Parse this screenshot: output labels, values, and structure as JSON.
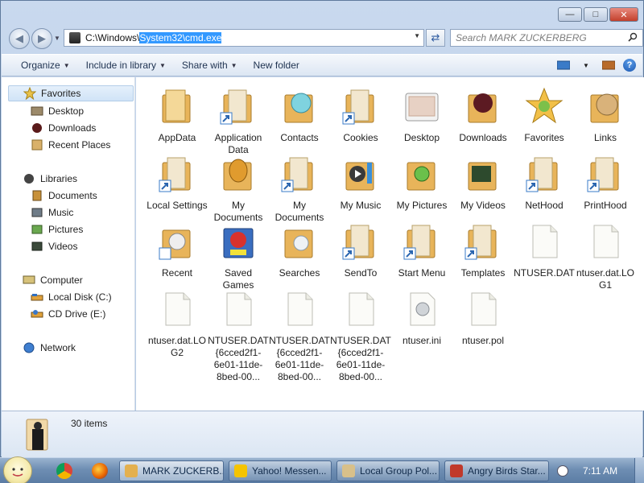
{
  "address": {
    "path_prefix": "C:\\Windows\\",
    "path_selected": "System32\\cmd.exe"
  },
  "search": {
    "placeholder": "Search MARK ZUCKERBERG"
  },
  "toolbar": {
    "organize": "Organize",
    "include_in_library": "Include in library",
    "share_with": "Share with",
    "new_folder": "New folder"
  },
  "nav": {
    "favorites": "Favorites",
    "desktop": "Desktop",
    "downloads": "Downloads",
    "recent_places": "Recent Places",
    "libraries": "Libraries",
    "documents": "Documents",
    "music": "Music",
    "pictures": "Pictures",
    "videos": "Videos",
    "computer": "Computer",
    "local_disk": "Local Disk (C:)",
    "cd_drive": "CD Drive (E:)",
    "network": "Network"
  },
  "files": [
    {
      "label": "AppData",
      "icon": "folder-icon"
    },
    {
      "label": "Application Data",
      "icon": "folder-shortcut-icon"
    },
    {
      "label": "Contacts",
      "icon": "contacts-folder-icon"
    },
    {
      "label": "Cookies",
      "icon": "folder-shortcut-icon"
    },
    {
      "label": "Desktop",
      "icon": "desktop-folder-icon"
    },
    {
      "label": "Downloads",
      "icon": "downloads-folder-icon"
    },
    {
      "label": "Favorites",
      "icon": "favorites-folder-icon"
    },
    {
      "label": "Links",
      "icon": "links-folder-icon"
    },
    {
      "label": "Local Settings",
      "icon": "folder-shortcut-icon"
    },
    {
      "label": "My Documents",
      "icon": "documents-folder-icon"
    },
    {
      "label": "My Documents",
      "icon": "folder-shortcut-icon"
    },
    {
      "label": "My Music",
      "icon": "music-folder-icon"
    },
    {
      "label": "My Pictures",
      "icon": "pictures-folder-icon"
    },
    {
      "label": "My Videos",
      "icon": "videos-folder-icon"
    },
    {
      "label": "NetHood",
      "icon": "folder-shortcut-icon"
    },
    {
      "label": "PrintHood",
      "icon": "folder-shortcut-icon"
    },
    {
      "label": "Recent",
      "icon": "recent-folder-icon"
    },
    {
      "label": "Saved Games",
      "icon": "saved-games-folder-icon"
    },
    {
      "label": "Searches",
      "icon": "searches-folder-icon"
    },
    {
      "label": "SendTo",
      "icon": "folder-shortcut-icon"
    },
    {
      "label": "Start Menu",
      "icon": "folder-shortcut-icon"
    },
    {
      "label": "Templates",
      "icon": "folder-shortcut-icon"
    },
    {
      "label": "NTUSER.DAT",
      "icon": "file-icon"
    },
    {
      "label": "ntuser.dat.LOG1",
      "icon": "file-icon"
    },
    {
      "label": "ntuser.dat.LOG2",
      "icon": "file-icon"
    },
    {
      "label": "NTUSER.DAT{6cced2f1-6e01-11de-8bed-00...",
      "icon": "file-icon"
    },
    {
      "label": "NTUSER.DAT{6cced2f1-6e01-11de-8bed-00...",
      "icon": "file-icon"
    },
    {
      "label": "NTUSER.DAT{6cced2f1-6e01-11de-8bed-00...",
      "icon": "file-icon"
    },
    {
      "label": "ntuser.ini",
      "icon": "settings-file-icon"
    },
    {
      "label": "ntuser.pol",
      "icon": "file-icon"
    }
  ],
  "status": {
    "item_count": "30 items"
  },
  "taskbar": {
    "buttons": [
      {
        "label": "MARK ZUCKERB...",
        "icon": "explorer-icon"
      },
      {
        "label": "Yahoo! Messen...",
        "icon": "yahoo-messenger-icon"
      },
      {
        "label": "Local Group Pol...",
        "icon": "group-policy-icon"
      },
      {
        "label": "Angry Birds Star...",
        "icon": "angry-birds-icon"
      }
    ],
    "clock": "7:11 AM"
  },
  "colors": {
    "selection": "#3399ff",
    "toolbar_text": "#1e3250",
    "close_button": "#c3402c"
  }
}
